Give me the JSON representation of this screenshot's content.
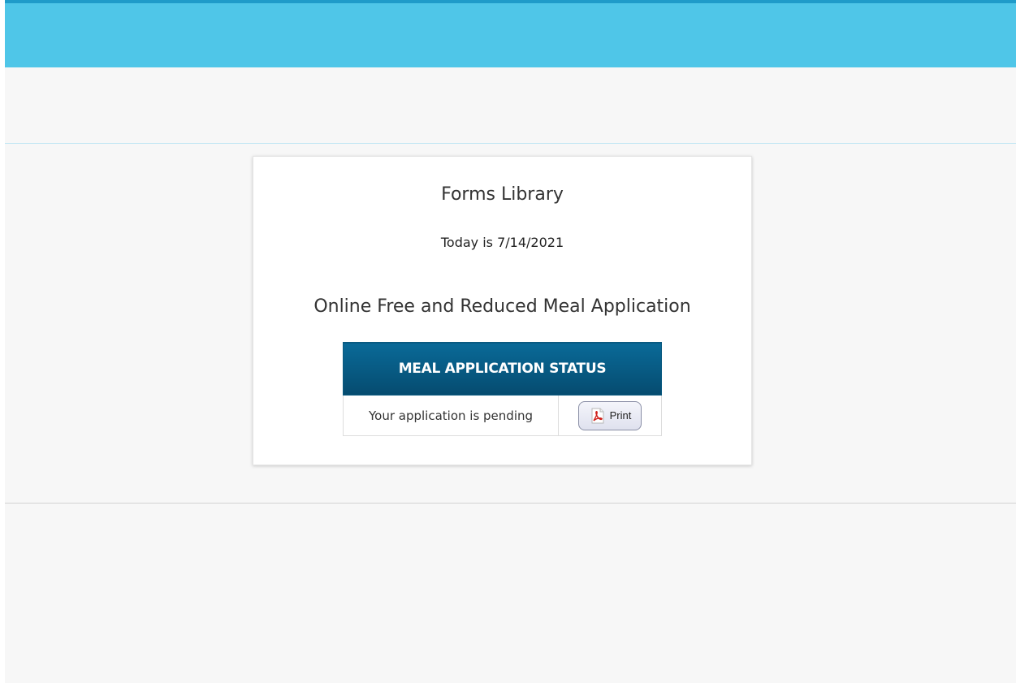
{
  "card": {
    "title": "Forms Library",
    "today_text": "Today is 7/14/2021",
    "section_title": "Online Free and Reduced Meal Application"
  },
  "status_table": {
    "header": "MEAL APPLICATION STATUS",
    "status_text": "Your application is pending",
    "print_label": "Print",
    "print_icon": "pdf-icon"
  },
  "colors": {
    "top_bar": "#4fc6e8",
    "table_header": "#0a6a98",
    "page_background": "#f7f7f7"
  }
}
